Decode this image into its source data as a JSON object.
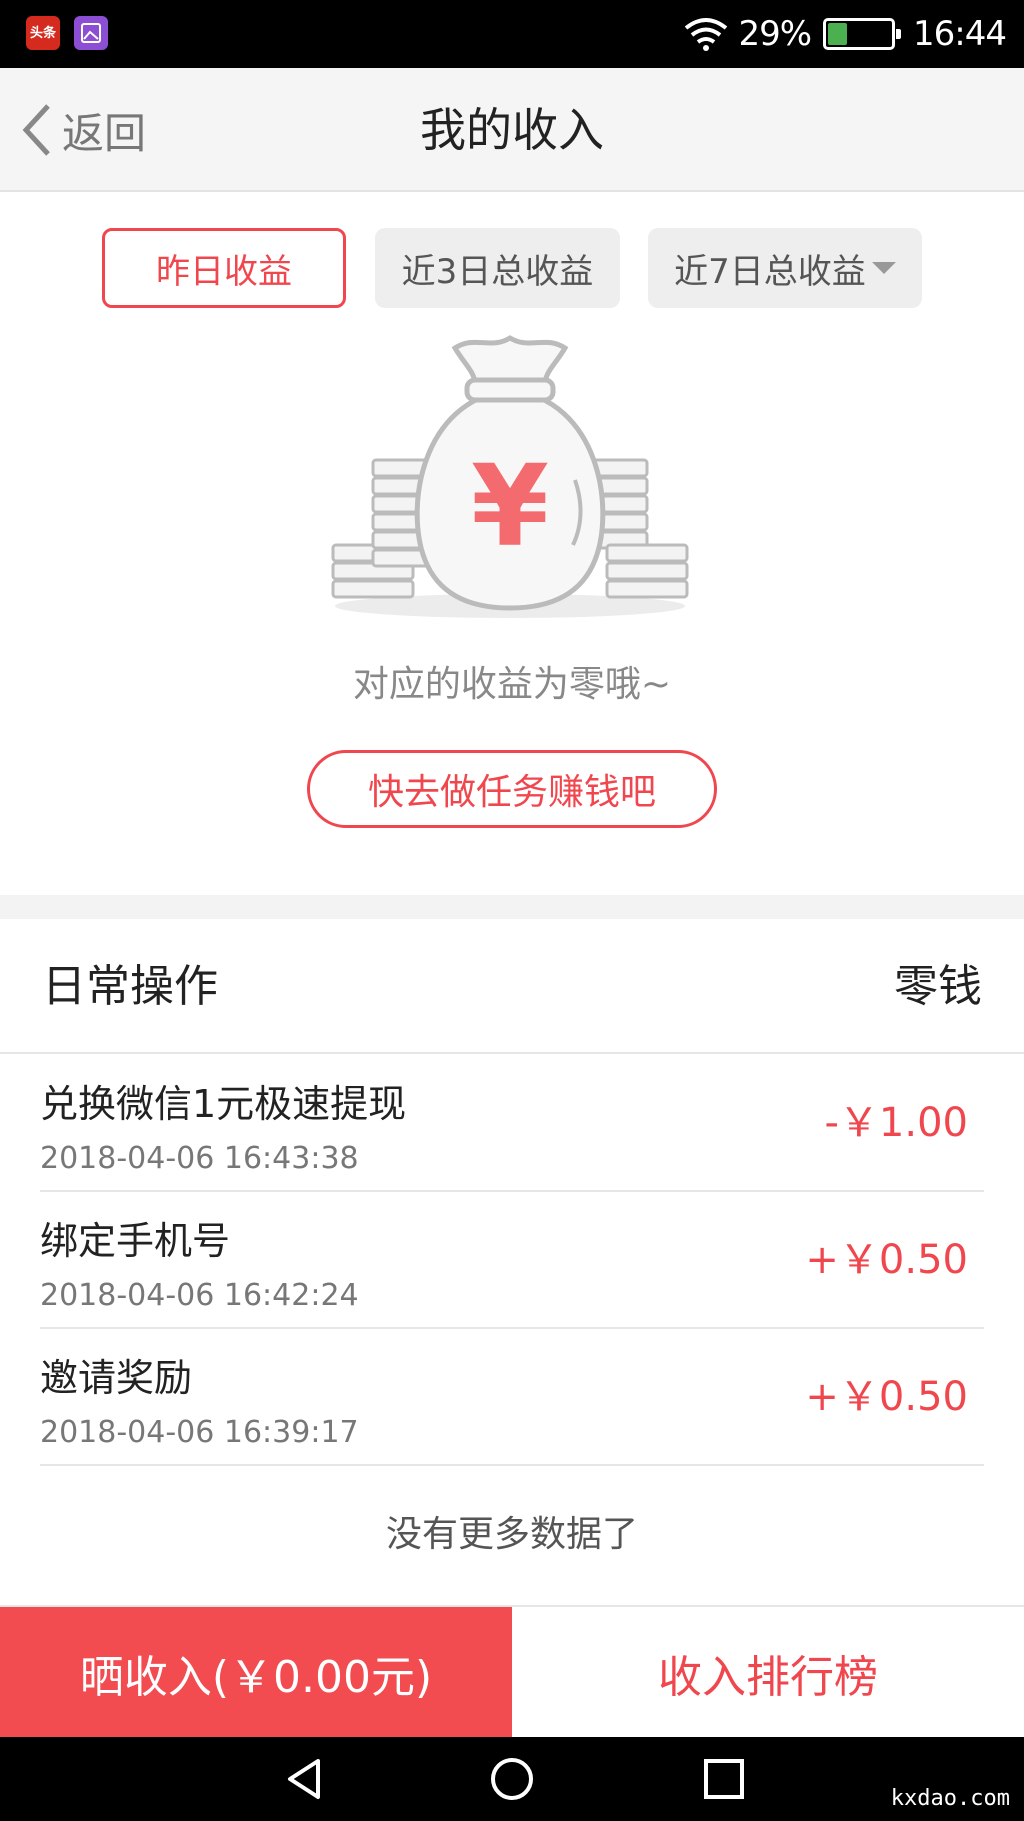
{
  "status_bar": {
    "battery": "29%",
    "time": "16:44",
    "app_icon_1_text": "头条",
    "battery_level": 0.29
  },
  "header": {
    "back_label": "返回",
    "title": "我的收入"
  },
  "tabs": [
    {
      "label": "昨日收益",
      "active": true
    },
    {
      "label": "近3日总收益",
      "active": false
    },
    {
      "label": "近7日总收益",
      "active": false
    }
  ],
  "empty_state": {
    "message": "对应的收益为零哦~",
    "task_button": "快去做任务赚钱吧",
    "icon": "money-bag-icon",
    "symbol": "¥"
  },
  "list": {
    "title": "日常操作",
    "right_label": "零钱",
    "records": [
      {
        "title": "兑换微信1元极速提现",
        "time": "2018-04-06 16:43:38",
        "amount": "-￥1.00"
      },
      {
        "title": "绑定手机号",
        "time": "2018-04-06 16:42:24",
        "amount": "+￥0.50"
      },
      {
        "title": "邀请奖励",
        "time": "2018-04-06 16:39:17",
        "amount": "+￥0.50"
      }
    ],
    "no_more": "没有更多数据了"
  },
  "bottom": {
    "share_label": "晒收入(￥0.00元)",
    "rank_label": "收入排行榜"
  },
  "watermark": "kxdao.com",
  "colors": {
    "accent": "#f0474e",
    "share_bg": "#f24b50"
  }
}
